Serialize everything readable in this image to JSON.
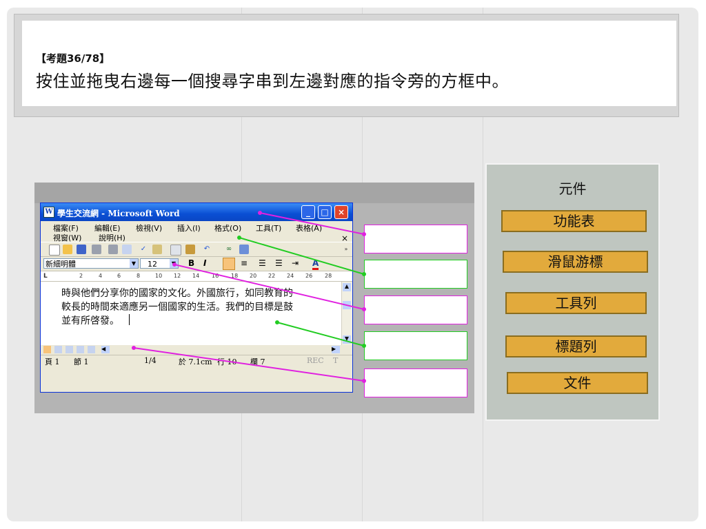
{
  "header": {
    "exam_number": "【考題36/78】",
    "instruction": "按住並拖曳右邊每一個搜尋字串到左邊對應的指令旁的方框中。"
  },
  "word_window": {
    "title": "學生交流網 - Microsoft Word",
    "menus": [
      "檔案(F)",
      "編輯(E)",
      "檢視(V)",
      "插入(I)",
      "格式(O)",
      "工具(T)",
      "表格(A)",
      "視窗(W)",
      "說明(H)"
    ],
    "font_name": "新細明體",
    "font_size": "12",
    "ruler_numbers": [
      "2",
      "4",
      "6",
      "8",
      "10",
      "12",
      "14",
      "16",
      "18",
      "20",
      "22",
      "24",
      "26",
      "28"
    ],
    "document_lines": [
      "時與他們分享你的國家的文化。外國旅行，如同教育的",
      "較長的時間來適應另一個國家的生活。我們的目標是鼓",
      "並有所啓發。"
    ],
    "status": {
      "page": "頁 1",
      "section": "節 1",
      "page_count": "1/4",
      "position": "於 7.1cm",
      "line": "行 10",
      "column": "欄 7",
      "rec": "REC",
      "trk": "T"
    }
  },
  "panel": {
    "title": "元件",
    "items": [
      "功能表",
      "滑鼠游標",
      "工具列",
      "標題列",
      "文件"
    ]
  },
  "colors": {
    "magenta_line": "#e020e0",
    "green_line": "#22cc22",
    "tag_fill": "#e2aa3c",
    "panel_bg": "#bfc6c0"
  }
}
